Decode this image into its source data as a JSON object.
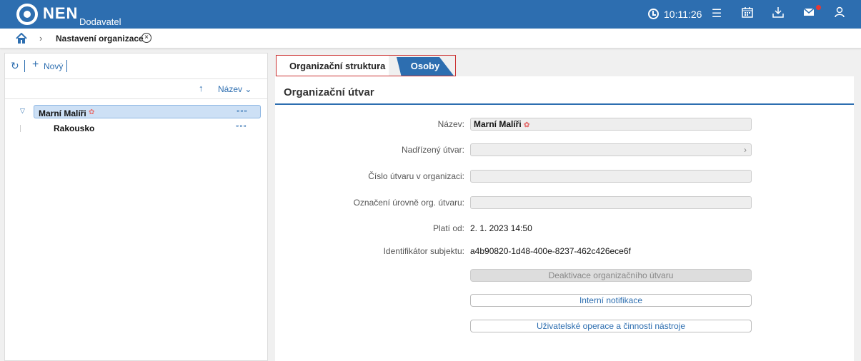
{
  "app": {
    "logo": "NEN",
    "subtitle": "Dodavatel",
    "time": "10:11:26"
  },
  "breadcrumb": {
    "title": "Nastavení organizace"
  },
  "left": {
    "new_label": "Nový",
    "sort_label": "Název",
    "tree": [
      {
        "label": "Marní Malíři"
      },
      {
        "label": "Rakousko"
      }
    ]
  },
  "tabs": [
    {
      "label": "Organizační struktura"
    },
    {
      "label": "Osoby"
    }
  ],
  "section": {
    "title": "Organizační útvar"
  },
  "form": {
    "name_label": "Název:",
    "name_value": "Marní Malíři",
    "parent_label": "Nadřízený útvar:",
    "number_label": "Číslo útvaru v organizaci:",
    "level_label": "Označení úrovně org. útvaru:",
    "valid_label": "Platí od:",
    "valid_value": "2. 1. 2023 14:50",
    "id_label": "Identifikátor subjektu:",
    "id_value": "a4b90820-1d48-400e-8237-462c426ece6f"
  },
  "buttons": {
    "deactivate": "Deaktivace organizačního útvaru",
    "notifications": "Interní notifikace",
    "operations": "Uživatelské operace a činnosti nástroje"
  },
  "colors": {
    "brand": "#2d6eb0",
    "tab_border": "#cc3333"
  }
}
